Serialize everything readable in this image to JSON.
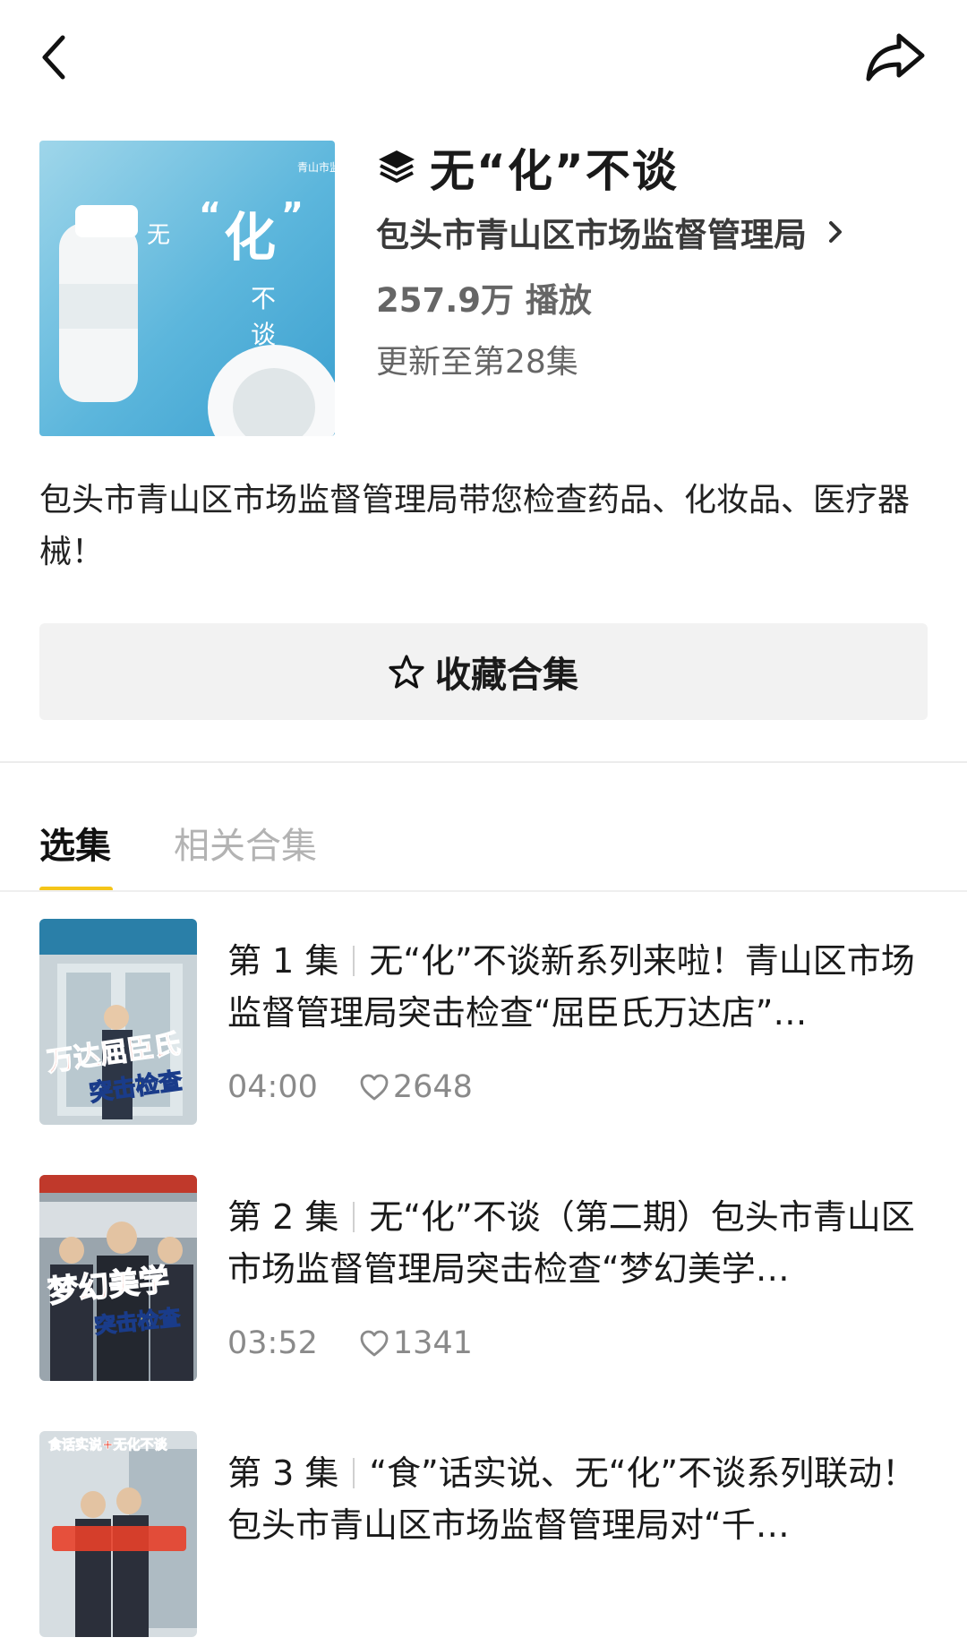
{
  "header": {
    "back_icon": "chevron-left-icon",
    "share_icon": "share-arrow-icon"
  },
  "collection": {
    "cover_texts": {
      "logo": "青山市监",
      "wu": "无",
      "hua": "化",
      "bu": "不",
      "tan": "谈"
    },
    "title": "无“化”不谈",
    "author": "包头市青山区市场监督管理局",
    "plays": "257.9万 播放",
    "update": "更新至第28集",
    "description": "包头市青山区市场监督管理局带您检查药品、化妆品、医疗器械！"
  },
  "collect_button": {
    "label": "收藏合集",
    "icon": "star-outline-icon"
  },
  "tabs": [
    {
      "label": "选集",
      "active": true
    },
    {
      "label": "相关合集",
      "active": false
    }
  ],
  "accent_color": "#f5c518",
  "episodes": [
    {
      "number": "第 1 集",
      "title": "无“化”不谈新系列来啦！青山区市场监督管理局突击检查“屈臣氏万达店”…",
      "duration": "04:00",
      "likes": "2648",
      "thumb_lines": [
        "万达屈臣氏",
        "突击检查"
      ]
    },
    {
      "number": "第 2 集",
      "title": "无“化”不谈（第二期）包头市青山区市场监督管理局突击检查“梦幻美学…",
      "duration": "03:52",
      "likes": "1341",
      "thumb_lines": [
        "梦幻美学",
        "突击检查"
      ]
    },
    {
      "number": "第 3 集",
      "title": "“食”话实说、无“化”不谈系列联动！包头市青山区市场监督管理局对“千…",
      "duration": "",
      "likes": "",
      "thumb_lines": [
        "食话实说+无化不谈",
        ""
      ]
    }
  ]
}
